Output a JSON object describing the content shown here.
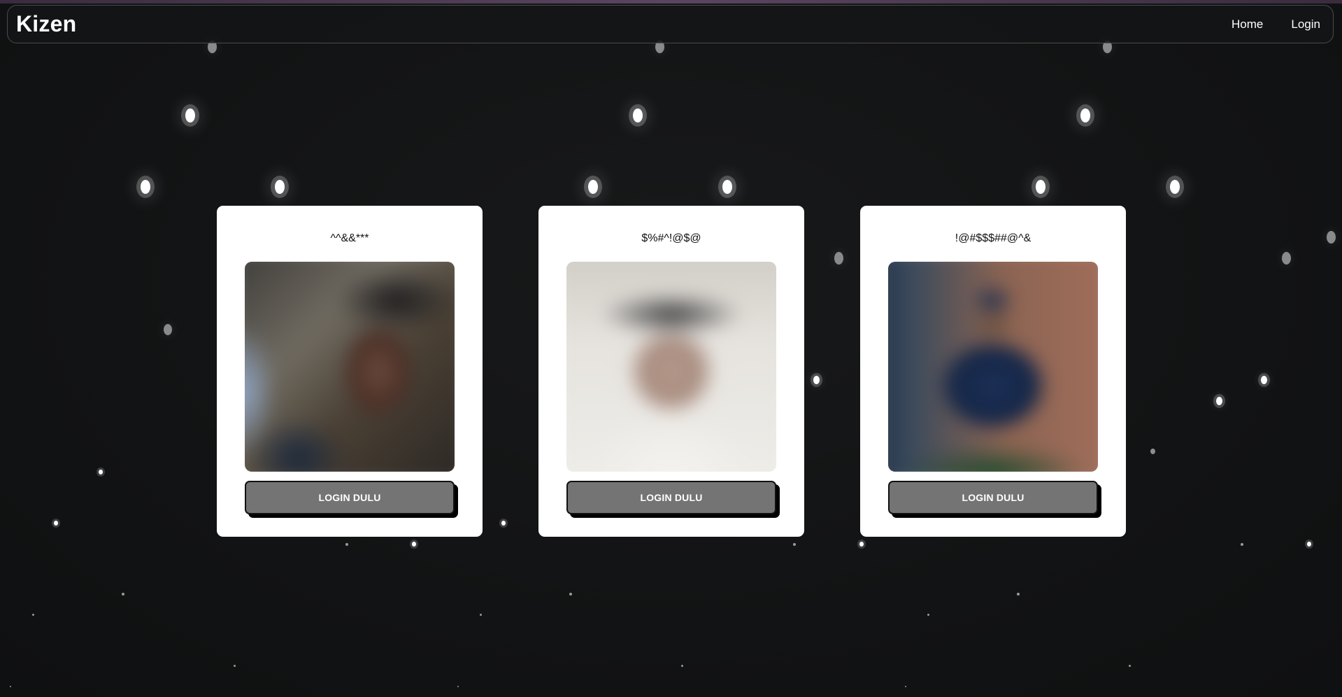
{
  "navbar": {
    "brand": "Kizen",
    "links": [
      {
        "label": "Home"
      },
      {
        "label": "Login"
      }
    ]
  },
  "cards": [
    {
      "title": "^^&&***",
      "button_label": "LOGIN DULU"
    },
    {
      "title": "$%#^!@$@",
      "button_label": "LOGIN DULU"
    },
    {
      "title": "!@#$$$##@^&",
      "button_label": "LOGIN DULU"
    }
  ],
  "theme": {
    "background": "#121314",
    "card_background": "#ffffff",
    "button_background": "#747474",
    "text_light": "#ffffff"
  }
}
